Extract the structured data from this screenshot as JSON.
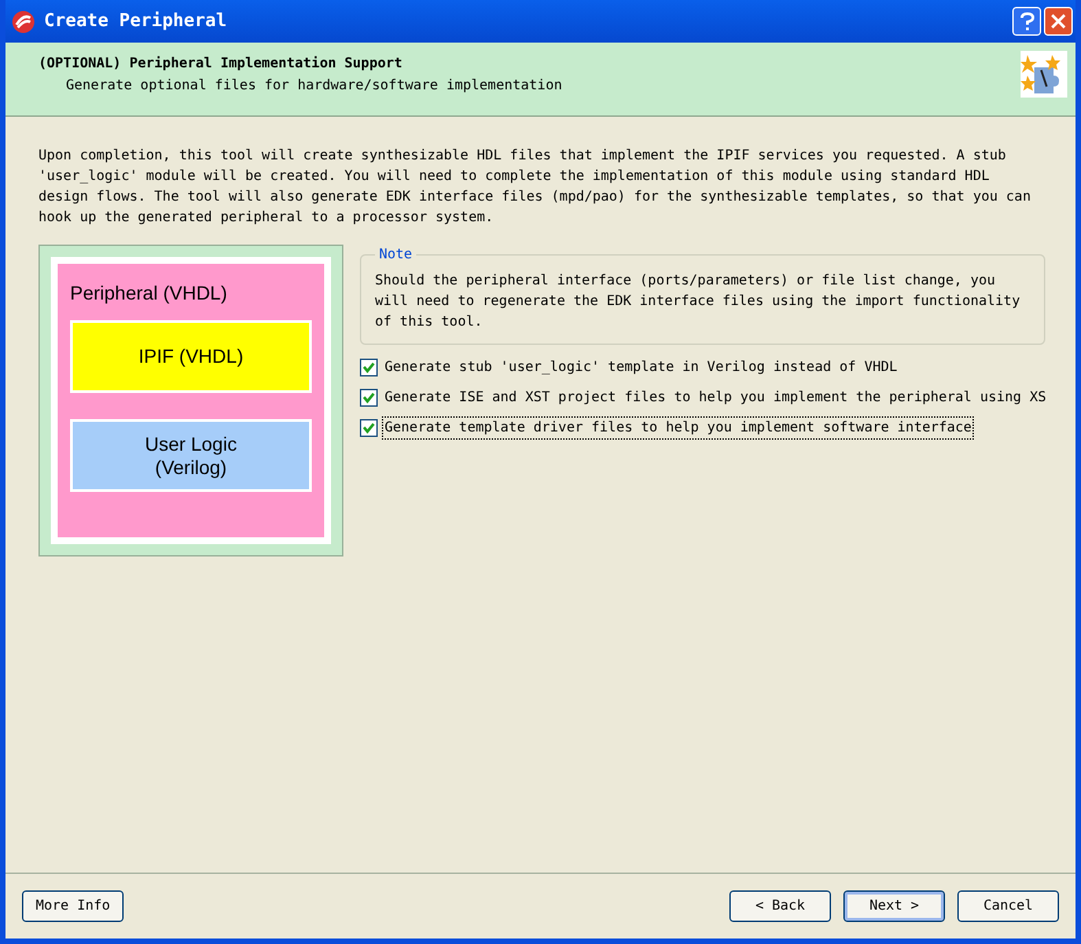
{
  "window": {
    "title": "Create Peripheral"
  },
  "header": {
    "title": "(OPTIONAL) Peripheral Implementation Support",
    "subtitle": "Generate optional files for hardware/software implementation"
  },
  "description": "Upon completion, this tool will create synthesizable HDL files that implement the IPIF services you requested. A stub 'user_logic' module will be created. You will need to complete the implementation of this module using standard HDL design flows. The tool will also generate EDK interface files (mpd/pao) for the synthesizable templates, so that you can hook up the generated peripheral to a processor system.",
  "diagram": {
    "outer": "Peripheral (VHDL)",
    "blocks": [
      {
        "label": "IPIF (VHDL)",
        "color": "#ffff00"
      },
      {
        "label": "User Logic\n(Verilog)",
        "color": "#a6cdf9"
      }
    ]
  },
  "note": {
    "title": "Note",
    "text": "Should the peripheral interface (ports/parameters) or file list change, you will need to regenerate the EDK interface files using the import functionality of this tool."
  },
  "options": [
    {
      "label": "Generate stub 'user_logic' template in Verilog instead of VHDL",
      "checked": true,
      "focused": false
    },
    {
      "label": "Generate ISE and XST project files to help you implement the peripheral using XS",
      "checked": true,
      "focused": false
    },
    {
      "label": "Generate template driver files to help you implement software interface",
      "checked": true,
      "focused": true
    }
  ],
  "buttons": {
    "more_info": "More Info",
    "back": "< Back",
    "next": "Next >",
    "cancel": "Cancel"
  }
}
